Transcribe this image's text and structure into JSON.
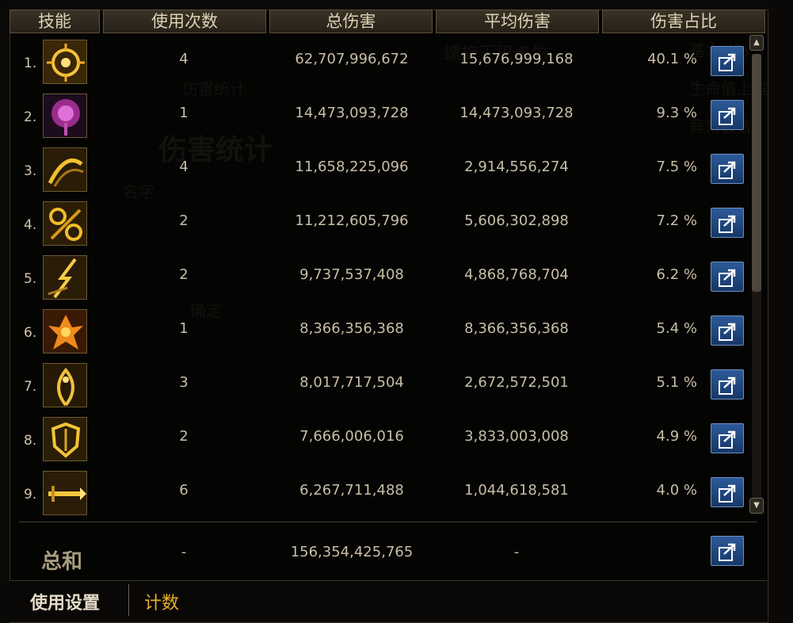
{
  "header": {
    "columns": [
      "技能",
      "使用次数",
      "总伤害",
      "平均伤害",
      "伤害占比"
    ]
  },
  "rows": [
    {
      "rank": "1.",
      "icon": "radiant-sun-skill-icon",
      "uses": "4",
      "total": "62,707,996,672",
      "average": "15,676,999,168",
      "share": "40.1 %"
    },
    {
      "rank": "2.",
      "icon": "pink-burst-tree-skill-icon",
      "uses": "1",
      "total": "14,473,093,728",
      "average": "14,473,093,728",
      "share": "9.3 %"
    },
    {
      "rank": "3.",
      "icon": "spiral-slash-skill-icon",
      "uses": "4",
      "total": "11,658,225,096",
      "average": "2,914,556,274",
      "share": "7.5 %"
    },
    {
      "rank": "4.",
      "icon": "golden-orbs-skill-icon",
      "uses": "2",
      "total": "11,212,605,796",
      "average": "5,606,302,898",
      "share": "7.2 %"
    },
    {
      "rank": "5.",
      "icon": "lightning-strike-skill-icon",
      "uses": "2",
      "total": "9,737,537,408",
      "average": "4,868,768,704",
      "share": "6.2 %"
    },
    {
      "rank": "6.",
      "icon": "phoenix-fire-skill-icon",
      "uses": "1",
      "total": "8,366,356,368",
      "average": "8,366,356,368",
      "share": "5.4 %"
    },
    {
      "rank": "7.",
      "icon": "holy-vine-skill-icon",
      "uses": "3",
      "total": "8,017,717,504",
      "average": "2,672,572,501",
      "share": "5.1 %"
    },
    {
      "rank": "8.",
      "icon": "shield-rays-skill-icon",
      "uses": "2",
      "total": "7,666,006,016",
      "average": "3,833,003,008",
      "share": "4.9 %"
    },
    {
      "rank": "9.",
      "icon": "sword-thrust-skill-icon",
      "uses": "6",
      "total": "6,267,711,488",
      "average": "1,044,618,581",
      "share": "4.0 %"
    }
  ],
  "summary": {
    "label": "总和",
    "uses": "-",
    "total": "156,354,425,765",
    "average": "-"
  },
  "tabs": {
    "settings": "使用设置",
    "count": "计数"
  },
  "colors": {
    "accent_gold": "#e8b02a",
    "button_blue": "#1f4a86",
    "text": "#c8bea6"
  }
}
